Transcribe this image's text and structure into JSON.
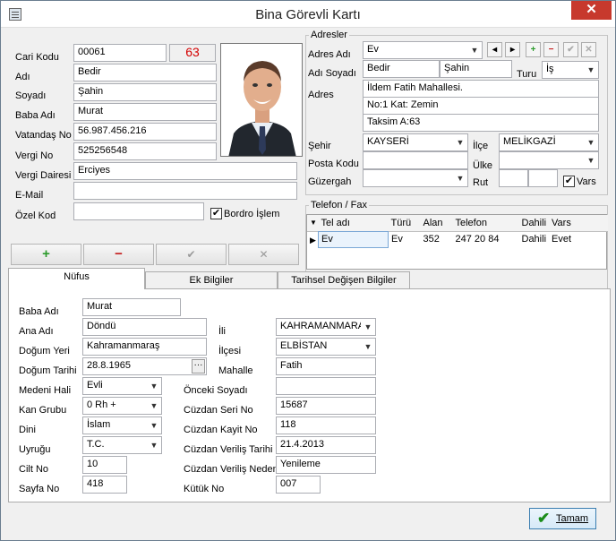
{
  "window": {
    "title": "Bina Görevli Kartı",
    "close_label": "✕"
  },
  "card": {
    "cari_kodu_label": "Cari Kodu",
    "cari_kodu": "00061",
    "counter": "63",
    "adi_label": "Adı",
    "adi": "Bedir",
    "soyadi_label": "Soyadı",
    "soyadi": "Şahin",
    "baba_adi_label": "Baba Adı",
    "baba_adi": "Murat",
    "vatandas_no_label": "Vatandaş No",
    "vatandas_no": "56.987.456.216",
    "vergi_no_label": "Vergi No",
    "vergi_no": "525256548",
    "vergi_dairesi_label": "Vergi Dairesi",
    "vergi_dairesi": "Erciyes",
    "email_label": "E-Mail",
    "email": "",
    "ozel_kod_label": "Özel Kod",
    "ozel_kod": "",
    "bordro_label": "Bordro İşlem",
    "bordro_checked": true
  },
  "nav_buttons": {
    "add": "+",
    "remove": "−",
    "confirm": "✔",
    "cancel": "✕"
  },
  "adresler": {
    "group_title": "Adresler",
    "adres_adi_label": "Adres Adı",
    "adres_adi": "Ev",
    "adi_soyadi_label": "Adı Soyadı",
    "adi": "Bedir",
    "soyadi": "Şahin",
    "turu_label": "Turu",
    "turu": "İş",
    "adres_label": "Adres",
    "adres_lines": [
      "İldem Fatih Mahallesi.",
      "No:1 Kat: Zemin",
      "Taksim A:63"
    ],
    "sehir_label": "Şehir",
    "sehir": "KAYSERİ",
    "ilce_label": "İlçe",
    "ilce": "MELİKGAZİ",
    "posta_kodu_label": "Posta Kodu",
    "posta_kodu": "",
    "ulke_label": "Ülke",
    "ulke": "",
    "guzergah_label": "Güzergah",
    "guzergah": "",
    "rut_label": "Rut",
    "rut": "",
    "vars_label": "Vars",
    "vars_checked": true
  },
  "telefon": {
    "group_title": "Telefon / Fax",
    "columns": [
      "Tel adı",
      "Türü",
      "Alan",
      "Telefon",
      "Dahili",
      "Vars"
    ],
    "rows": [
      [
        "Ev",
        "Ev",
        "352",
        "247 20 84",
        "Dahili",
        "Evet"
      ]
    ]
  },
  "tabs": [
    "Nüfus",
    "Ek Bilgiler",
    "Tarihsel Değişen Bilgiler"
  ],
  "nufus": {
    "baba_adi_label": "Baba Adı",
    "baba_adi": "Murat",
    "ana_adi_label": "Ana Adı",
    "ana_adi": "Döndü",
    "dogum_yeri_label": "Doğum Yeri",
    "dogum_yeri": "Kahramanmaraş",
    "dogum_tarihi_label": "Doğum Tarihi",
    "dogum_tarihi": "28.8.1965",
    "medeni_hali_label": "Medeni Hali",
    "medeni_hali": "Evli",
    "kan_grubu_label": "Kan Grubu",
    "kan_grubu": "0 Rh +",
    "dini_label": "Dini",
    "dini": "İslam",
    "uyrugu_label": "Uyruğu",
    "uyrugu": "T.C.",
    "cilt_no_label": "Cilt No",
    "cilt_no": "10",
    "sayfa_no_label": "Sayfa No",
    "sayfa_no": "418",
    "ili_label": "İli",
    "ili": "KAHRAMANMARAŞ",
    "ilcesi_label": "İlçesi",
    "ilcesi": "ELBİSTAN",
    "mahalle_label": "Mahalle",
    "mahalle": "Fatih",
    "onceki_soyadi_label": "Önceki Soyadı",
    "onceki_soyadi": "",
    "cuzdan_seri_label": "Cüzdan Seri No",
    "cuzdan_seri": "15687",
    "cuzdan_kayit_label": "Cüzdan Kayit No",
    "cuzdan_kayit": "118",
    "cuzdan_verilis_tarihi_label": "Cüzdan Veriliş Tarihi",
    "cuzdan_verilis_tarihi": "21.4.2013",
    "cuzdan_verilis_nedeni_label": "Cüzdan Veriliş Nedeni",
    "cuzdan_verilis_nedeni": "Yenileme",
    "kutuk_no_label": "Kütük No",
    "kutuk_no": "007"
  },
  "footer": {
    "ok_label": "Tamam"
  }
}
